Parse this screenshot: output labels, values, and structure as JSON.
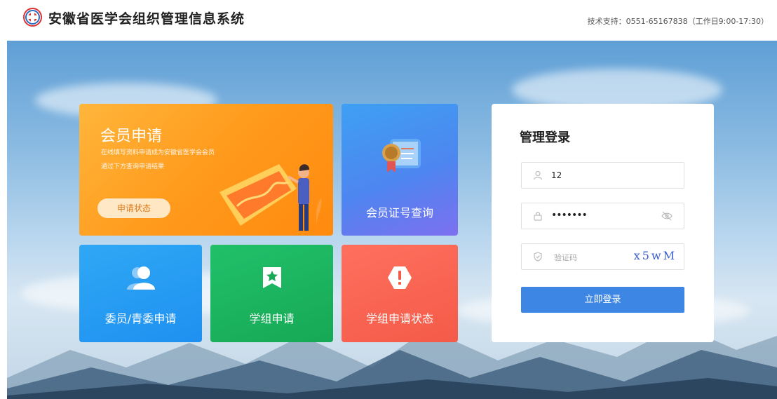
{
  "header": {
    "site_title": "安徽省医学会组织管理信息系统",
    "support_text": "技术支持：0551-65167838（工作日9:00-17:30）",
    "logo_icon": "association-logo-icon"
  },
  "tiles": {
    "member_application": {
      "title": "会员申请",
      "desc_line1": "在线填写资料申请成为安徽省医学会会员",
      "desc_line2": "通过下方查询申请结果",
      "status_button": "申请状态",
      "color": "#ff9a1c"
    },
    "certificate_query": {
      "label": "会员证号查询",
      "icon": "certificate-scroll-icon",
      "color": "#4d86f0"
    },
    "committee_application": {
      "label": "委员/青委申请",
      "icon": "users-icon",
      "color": "#1e90f0"
    },
    "group_application": {
      "label": "学组申请",
      "icon": "star-bookmark-icon",
      "color": "#16a855"
    },
    "group_application_status": {
      "label": "学组申请状态",
      "icon": "alert-hexagon-icon",
      "color": "#f45b48"
    }
  },
  "login": {
    "title": "管理登录",
    "username_value": "12",
    "password_value": "•••••••",
    "captcha_placeholder": "验证码",
    "captcha_text": "x5wM",
    "submit_label": "立即登录",
    "accent_color": "#3d86e3"
  }
}
